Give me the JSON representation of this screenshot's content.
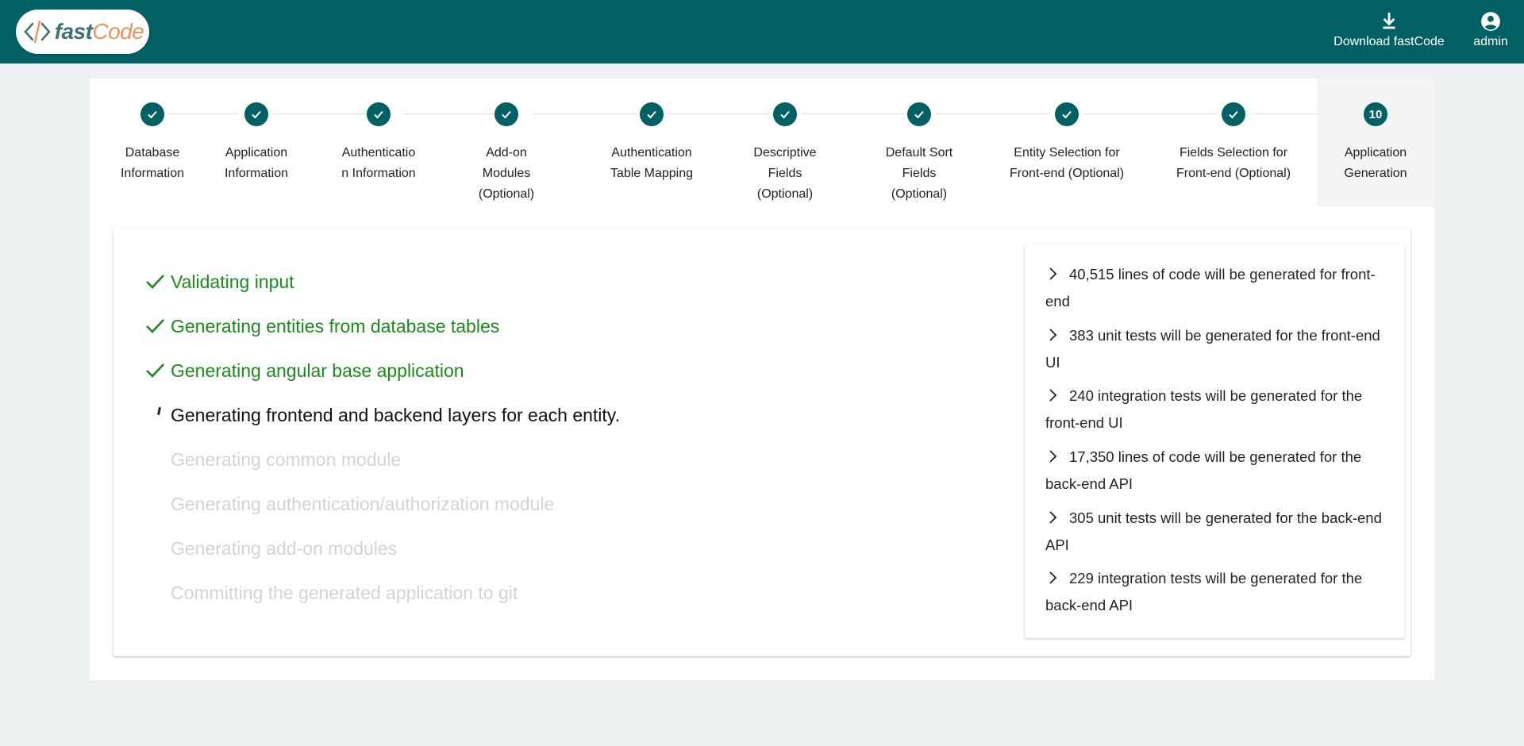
{
  "header": {
    "logo_fast": "fast",
    "logo_code": "Code",
    "download_label": "Download fastCode",
    "user_label": "admin"
  },
  "stepper": {
    "steps": [
      {
        "label": "Database\nInformation",
        "state": "done"
      },
      {
        "label": "Application\nInformation",
        "state": "done"
      },
      {
        "label": "Authenticatio\nn Information",
        "state": "done"
      },
      {
        "label": "Add-on\nModules\n(Optional)",
        "state": "done"
      },
      {
        "label": "Authentication\nTable Mapping",
        "state": "done"
      },
      {
        "label": "Descriptive\nFields\n(Optional)",
        "state": "done"
      },
      {
        "label": "Default Sort\nFields\n(Optional)",
        "state": "done"
      },
      {
        "label": "Entity Selection for\nFront-end (Optional)",
        "state": "done"
      },
      {
        "label": "Fields Selection for\nFront-end (Optional)",
        "state": "done"
      },
      {
        "label": "Application\nGeneration",
        "state": "active",
        "number": "10"
      }
    ]
  },
  "progress": [
    {
      "label": "Validating input",
      "state": "done"
    },
    {
      "label": "Generating entities from database tables",
      "state": "done"
    },
    {
      "label": "Generating angular base application",
      "state": "done"
    },
    {
      "label": "Generating frontend and backend layers for each entity.",
      "state": "current"
    },
    {
      "label": "Generating common module",
      "state": "pending"
    },
    {
      "label": "Generating authentication/authorization module",
      "state": "pending"
    },
    {
      "label": "Generating add-on modules",
      "state": "pending"
    },
    {
      "label": "Committing the generated application to git",
      "state": "pending"
    }
  ],
  "stats": [
    {
      "line1": "40,515 lines of code will be generated for front-",
      "line2": "end"
    },
    {
      "line1": "383 unit tests will be generated for the front-end",
      "line2": "UI"
    },
    {
      "line1": "240 integration tests will be generated for the",
      "line2": "front-end UI"
    },
    {
      "line1": "17,350 lines of code will be generated for the",
      "line2": "back-end API"
    },
    {
      "line1": "305 unit tests will be generated for the back-end",
      "line2": "API"
    },
    {
      "line1": "229 integration tests will be generated for the",
      "line2": "back-end API"
    }
  ],
  "colors": {
    "brand": "#006064",
    "done": "#1a8a1a",
    "pending": "#d0d4d6",
    "logo_orange": "#e8935e"
  }
}
